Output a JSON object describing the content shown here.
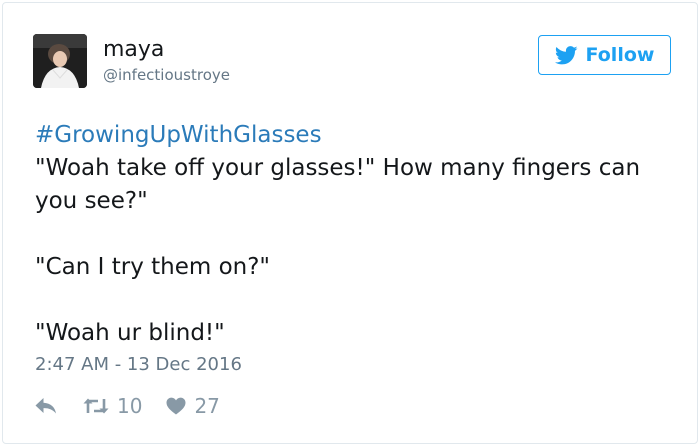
{
  "user": {
    "display_name": "maya",
    "handle": "@infectioustroye"
  },
  "follow_button": {
    "label": "Follow"
  },
  "tweet": {
    "hashtag": "#GrowingUpWithGlasses",
    "lines": [
      "\"Woah take off your glasses!\" How many fingers can you see?\"",
      "\"Can I try them on?\"",
      "\"Woah ur blind!\""
    ],
    "timestamp": "2:47 AM - 13 Dec 2016"
  },
  "actions": {
    "retweets": "10",
    "likes": "27"
  },
  "icons": {
    "follow": "twitter-bird-icon",
    "reply": "reply-icon",
    "retweet": "retweet-icon",
    "like": "heart-icon"
  },
  "colors": {
    "brand_blue": "#1da1f2",
    "hashtag": "#2b7bb9",
    "text": "#14171a",
    "muted": "#657786",
    "action_icon": "#8899a6",
    "border": "#e1e8ed"
  }
}
